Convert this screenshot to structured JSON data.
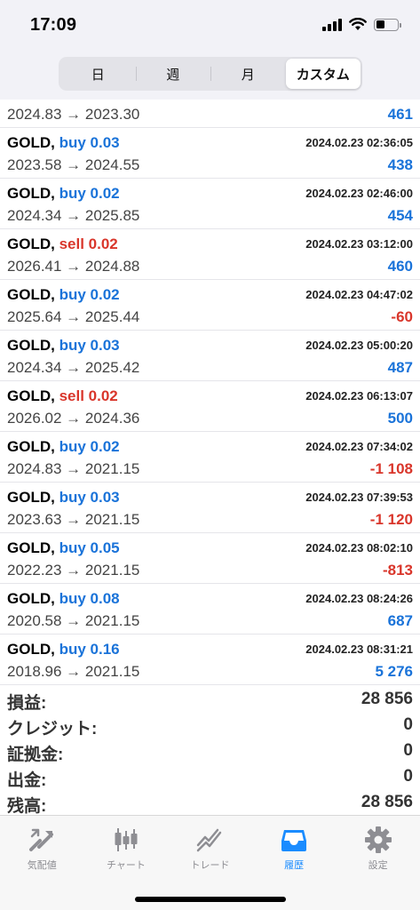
{
  "status": {
    "time": "17:09"
  },
  "segments": [
    {
      "label": "日"
    },
    {
      "label": "週"
    },
    {
      "label": "月"
    },
    {
      "label": "カスタム"
    }
  ],
  "first_row": {
    "prices": "2024.83 → 2023.30",
    "profit": "461"
  },
  "trades": [
    {
      "symbol": "GOLD,",
      "action": "buy 0.03",
      "time": "2024.02.23 02:36:05",
      "prices": "2023.58 → 2024.55",
      "profit": "438"
    },
    {
      "symbol": "GOLD,",
      "action": "buy 0.02",
      "time": "2024.02.23 02:46:00",
      "prices": "2024.34 → 2025.85",
      "profit": "454"
    },
    {
      "symbol": "GOLD,",
      "action": "sell 0.02",
      "time": "2024.02.23 03:12:00",
      "prices": "2026.41 → 2024.88",
      "profit": "460"
    },
    {
      "symbol": "GOLD,",
      "action": "buy 0.02",
      "time": "2024.02.23 04:47:02",
      "prices": "2025.64 → 2025.44",
      "profit": "-60"
    },
    {
      "symbol": "GOLD,",
      "action": "buy 0.03",
      "time": "2024.02.23 05:00:20",
      "prices": "2024.34 → 2025.42",
      "profit": "487"
    },
    {
      "symbol": "GOLD,",
      "action": "sell 0.02",
      "time": "2024.02.23 06:13:07",
      "prices": "2026.02 → 2024.36",
      "profit": "500"
    },
    {
      "symbol": "GOLD,",
      "action": "buy 0.02",
      "time": "2024.02.23 07:34:02",
      "prices": "2024.83 → 2021.15",
      "profit": "-1 108"
    },
    {
      "symbol": "GOLD,",
      "action": "buy 0.03",
      "time": "2024.02.23 07:39:53",
      "prices": "2023.63 → 2021.15",
      "profit": "-1 120"
    },
    {
      "symbol": "GOLD,",
      "action": "buy 0.05",
      "time": "2024.02.23 08:02:10",
      "prices": "2022.23 → 2021.15",
      "profit": "-813"
    },
    {
      "symbol": "GOLD,",
      "action": "buy 0.08",
      "time": "2024.02.23 08:24:26",
      "prices": "2020.58 → 2021.15",
      "profit": "687"
    },
    {
      "symbol": "GOLD,",
      "action": "buy 0.16",
      "time": "2024.02.23 08:31:21",
      "prices": "2018.96 → 2021.15",
      "profit": "5 276"
    }
  ],
  "summary": [
    {
      "label": "損益:",
      "value": "28 856"
    },
    {
      "label": "クレジット:",
      "value": "0"
    },
    {
      "label": "証拠金:",
      "value": "0"
    },
    {
      "label": "出金:",
      "value": "0"
    },
    {
      "label": "残高:",
      "value": "28 856"
    }
  ],
  "tabs": [
    {
      "label": "気配値",
      "icon": "quotes-icon"
    },
    {
      "label": "チャート",
      "icon": "chart-candles-icon"
    },
    {
      "label": "トレード",
      "icon": "trade-icon"
    },
    {
      "label": "履歴",
      "icon": "history-inbox-icon"
    },
    {
      "label": "設定",
      "icon": "gear-icon"
    }
  ],
  "colors": {
    "buy": "#1a73d9",
    "sell": "#d9362b",
    "active_tab": "#1a8cff"
  }
}
